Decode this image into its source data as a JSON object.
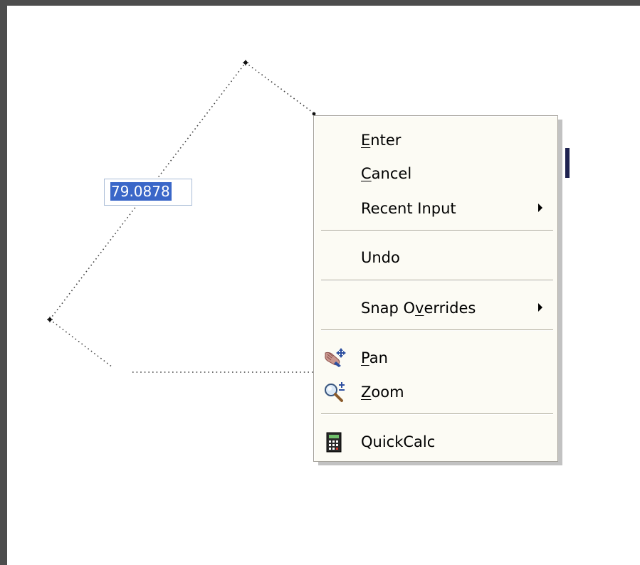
{
  "dynamic_input": {
    "value": "79.0878"
  },
  "context_menu": {
    "items": [
      {
        "pre": "",
        "mnemonic": "E",
        "post": "nter",
        "has_submenu": false
      },
      {
        "pre": "",
        "mnemonic": "C",
        "post": "ancel",
        "has_submenu": false
      },
      {
        "pre": "Recent Input",
        "mnemonic": "",
        "post": "",
        "has_submenu": true
      },
      {
        "pre": "Undo",
        "mnemonic": "",
        "post": "",
        "has_submenu": false
      },
      {
        "pre": "Snap O",
        "mnemonic": "v",
        "post": "errides",
        "has_submenu": true
      },
      {
        "pre": "",
        "mnemonic": "P",
        "post": "an",
        "icon": "pan-hand-icon",
        "has_submenu": false
      },
      {
        "pre": "",
        "mnemonic": "Z",
        "post": "oom",
        "icon": "zoom-magnifier-icon",
        "has_submenu": false
      },
      {
        "pre": "QuickCalc",
        "mnemonic": "",
        "post": "",
        "icon": "calculator-icon",
        "has_submenu": false
      }
    ]
  },
  "colors": {
    "window_border": "#4d4d4d",
    "menu_background": "#fcfbf4",
    "selection_highlight": "#3a67c8",
    "separator": "#aca899"
  }
}
